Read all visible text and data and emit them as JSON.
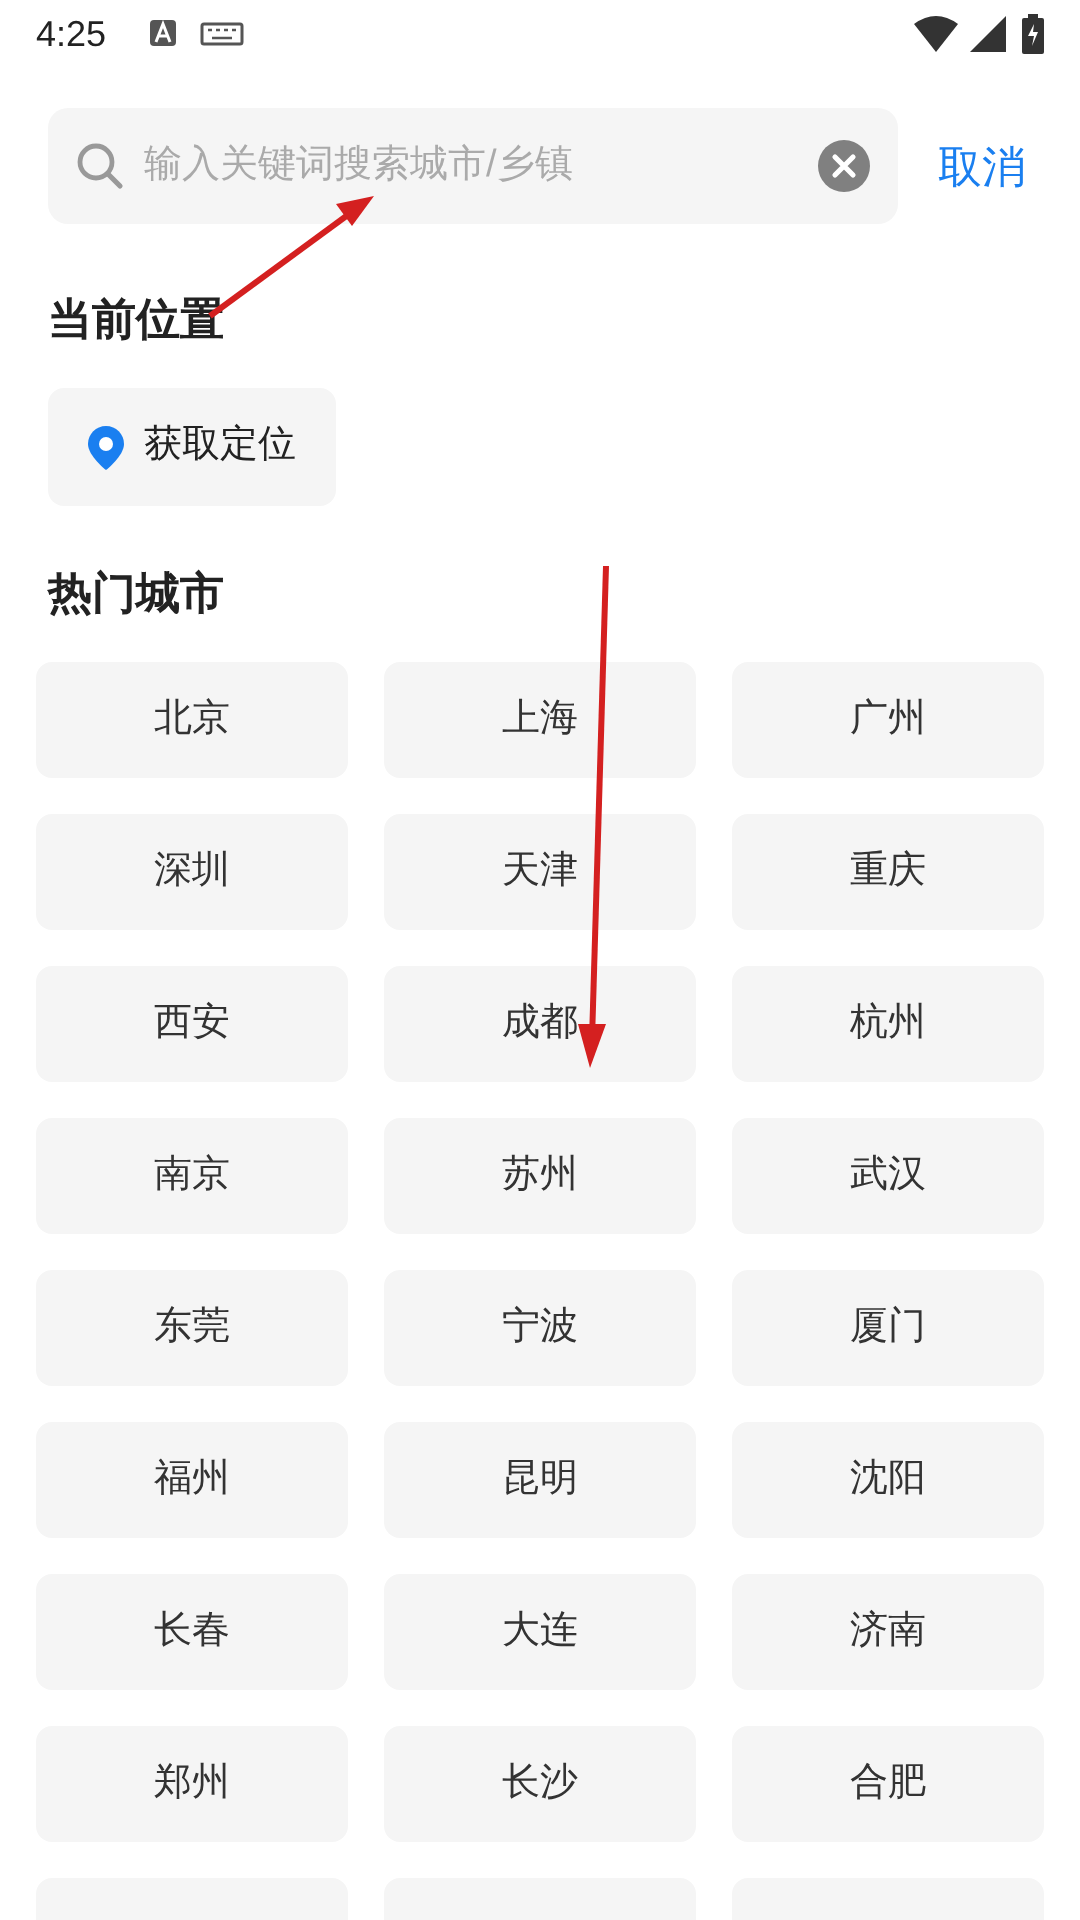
{
  "status_bar": {
    "time": "4:25"
  },
  "search": {
    "placeholder": "输入关键词搜索城市/乡镇",
    "cancel": "取消"
  },
  "current_location": {
    "heading": "当前位置",
    "button": "获取定位"
  },
  "hot_cities": {
    "heading": "热门城市",
    "cities": [
      "北京",
      "上海",
      "广州",
      "深圳",
      "天津",
      "重庆",
      "西安",
      "成都",
      "杭州",
      "南京",
      "苏州",
      "武汉",
      "东莞",
      "宁波",
      "厦门",
      "福州",
      "昆明",
      "沈阳",
      "长春",
      "大连",
      "济南",
      "郑州",
      "长沙",
      "合肥"
    ]
  }
}
